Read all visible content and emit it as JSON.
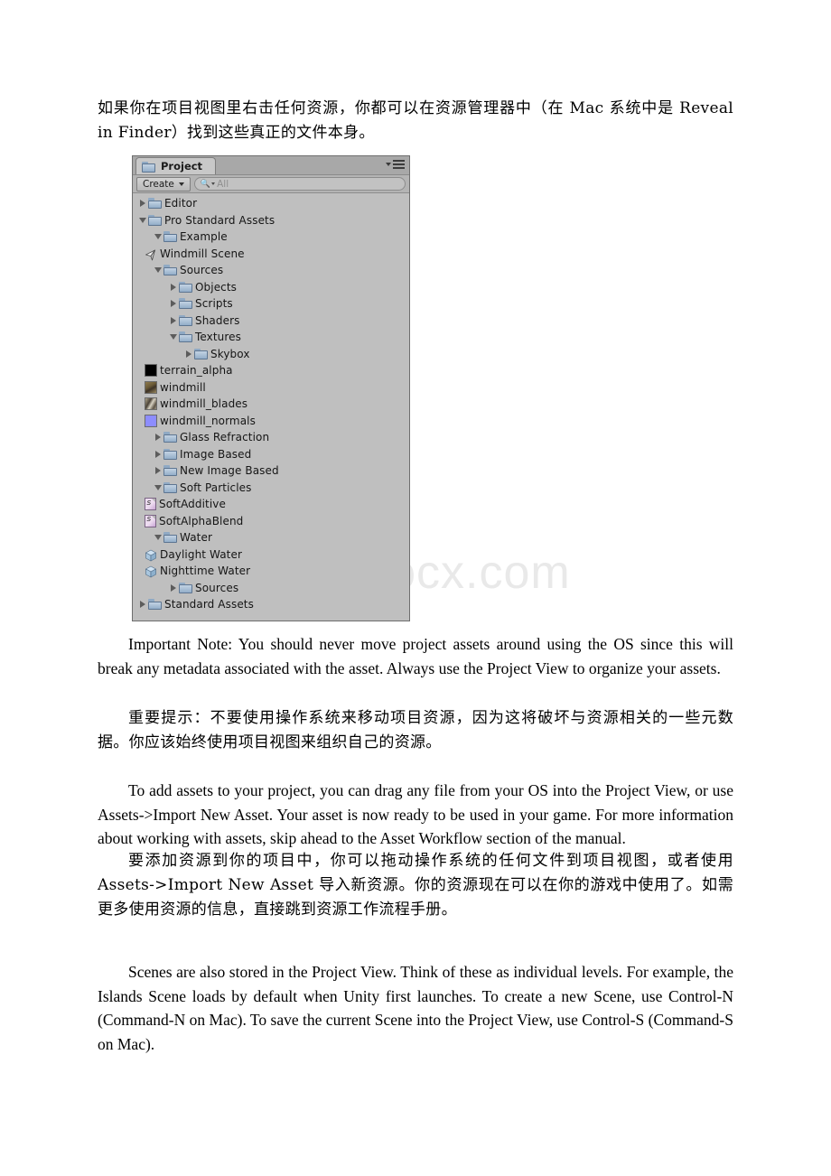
{
  "document": {
    "paragraphs": {
      "intro_cn": "如果你在项目视图里右击任何资源，你都可以在资源管理器中（在 Mac 系统中是 Reveal in Finder）找到这些真正的文件本身。",
      "important_note_en": "Important Note: You should never move project assets around using the OS since this will break any metadata associated with the asset. Always use the Project View to organize your assets.",
      "important_note_cn": "重要提示：不要使用操作系统来移动项目资源，因为这将破坏与资源相关的一些元数据。你应该始终使用项目视图来组织自己的资源。",
      "add_assets_en": "To add assets to your project, you can drag any file from your OS into the Project View, or use Assets->Import New Asset. Your asset is now ready to be used in your game. For more information about working with assets, skip ahead to the Asset Workflow section of the manual.",
      "add_assets_cn": "要添加资源到你的项目中，你可以拖动操作系统的任何文件到项目视图，或者使用 Assets->Import New Asset 导入新资源。你的资源现在可以在你的游戏中使用了。如需更多使用资源的信息，直接跳到资源工作流程手册。",
      "scenes_en": "Scenes are also stored in the Project View. Think of these as individual levels. For example, the Islands Scene loads by default when Unity first launches. To create a new Scene, use Control-N (Command-N on Mac). To save the current Scene into the Project View, use Control-S (Command-S on Mac)."
    },
    "watermark": "www.bdocx.com"
  },
  "unity_panel": {
    "tab": {
      "label": "Project",
      "icon": "folder-icon"
    },
    "menu_icon": "panel-menu-icon",
    "toolbar": {
      "create_label": "Create",
      "create_caret_icon": "chevron-down-icon",
      "search_icon": "search-icon",
      "search_placeholder": "All",
      "search_value": ""
    },
    "tree": [
      {
        "label": "Editor",
        "level": 0,
        "twisty": "right",
        "icon": "folder-icon"
      },
      {
        "label": "Pro Standard Assets",
        "level": 0,
        "twisty": "down",
        "icon": "folder-icon"
      },
      {
        "label": "Example",
        "level": 1,
        "twisty": "down",
        "icon": "folder-icon"
      },
      {
        "label": "Windmill Scene",
        "level": 2,
        "twisty": "none",
        "icon": "scene-icon"
      },
      {
        "label": "Sources",
        "level": 1,
        "twisty": "down",
        "icon": "folder-icon"
      },
      {
        "label": "Objects",
        "level": 2,
        "twisty": "right",
        "icon": "folder-icon"
      },
      {
        "label": "Scripts",
        "level": 2,
        "twisty": "right",
        "icon": "folder-icon"
      },
      {
        "label": "Shaders",
        "level": 2,
        "twisty": "right",
        "icon": "folder-icon"
      },
      {
        "label": "Textures",
        "level": 2,
        "twisty": "down",
        "icon": "folder-icon"
      },
      {
        "label": "Skybox",
        "level": 3,
        "twisty": "right",
        "icon": "folder-icon"
      },
      {
        "label": "terrain_alpha",
        "level": 3,
        "twisty": "none",
        "icon": "texture-black-icon"
      },
      {
        "label": "windmill",
        "level": 3,
        "twisty": "none",
        "icon": "texture-windmill-icon"
      },
      {
        "label": "windmill_blades",
        "level": 3,
        "twisty": "none",
        "icon": "texture-blades-icon"
      },
      {
        "label": "windmill_normals",
        "level": 3,
        "twisty": "none",
        "icon": "texture-normals-icon"
      },
      {
        "label": "Glass Refraction",
        "level": 1,
        "twisty": "right",
        "icon": "folder-icon"
      },
      {
        "label": "Image Based",
        "level": 1,
        "twisty": "right",
        "icon": "folder-icon"
      },
      {
        "label": "New Image Based",
        "level": 1,
        "twisty": "right",
        "icon": "folder-icon"
      },
      {
        "label": "Soft Particles",
        "level": 1,
        "twisty": "down",
        "icon": "folder-icon"
      },
      {
        "label": "SoftAdditive",
        "level": 2,
        "twisty": "none",
        "icon": "shader-icon"
      },
      {
        "label": "SoftAlphaBlend",
        "level": 2,
        "twisty": "none",
        "icon": "shader-icon"
      },
      {
        "label": "Water",
        "level": 1,
        "twisty": "down",
        "icon": "folder-icon"
      },
      {
        "label": "Daylight Water",
        "level": 2,
        "twisty": "none",
        "icon": "material-icon"
      },
      {
        "label": "Nighttime Water",
        "level": 2,
        "twisty": "none",
        "icon": "material-icon"
      },
      {
        "label": "Sources",
        "level": 2,
        "twisty": "right",
        "icon": "folder-icon"
      },
      {
        "label": "Standard Assets",
        "level": 0,
        "twisty": "right",
        "icon": "folder-icon"
      }
    ]
  }
}
